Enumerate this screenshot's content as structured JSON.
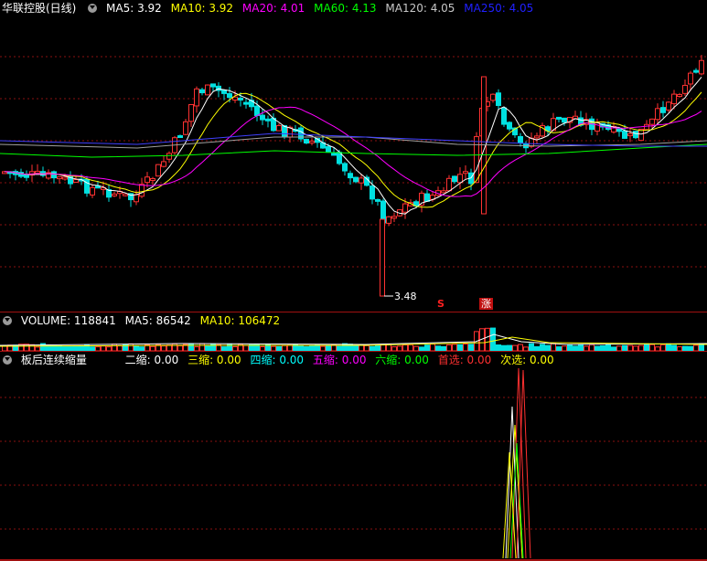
{
  "price_header": {
    "title": "华联控股(日线)",
    "ma": [
      {
        "label": "MA5: 3.92",
        "color": "#ffffff"
      },
      {
        "label": "MA10: 3.92",
        "color": "#ffff00"
      },
      {
        "label": "MA20: 4.01",
        "color": "#ff00ff"
      },
      {
        "label": "MA60: 4.13",
        "color": "#00ff00"
      },
      {
        "label": "MA120: 4.05",
        "color": "#c8c8c8"
      },
      {
        "label": "MA250: 4.05",
        "color": "#0000ff"
      }
    ]
  },
  "low_marker": "3.48",
  "signals": {
    "left": "S",
    "right": "涨"
  },
  "volume_header": {
    "label": "VOLUME: 118841",
    "ma5": "MA5: 86542",
    "ma10": "MA10: 106472"
  },
  "indicator_header": {
    "title": "板后连续缩量",
    "items": [
      {
        "label": "二缩: 0.00",
        "color": "#ffffff"
      },
      {
        "label": "三缩: 0.00",
        "color": "#ffff00"
      },
      {
        "label": "四缩: 0.00",
        "color": "#00ffff"
      },
      {
        "label": "五缩: 0.00",
        "color": "#ff00ff"
      },
      {
        "label": "六缩: 0.00",
        "color": "#00ff00"
      },
      {
        "label": "首选: 0.00",
        "color": "#ff3030"
      },
      {
        "label": "次选: 0.00",
        "color": "#ffff00"
      }
    ]
  },
  "colors": {
    "up": "#ff3232",
    "down": "#00e0e0",
    "ma5": "#ffffff",
    "ma10": "#ffff00",
    "ma20": "#ff00ff",
    "ma60": "#00ff00",
    "ma120": "#a0a0a0",
    "ma250": "#4040ff",
    "grid": "#8a1010"
  }
}
